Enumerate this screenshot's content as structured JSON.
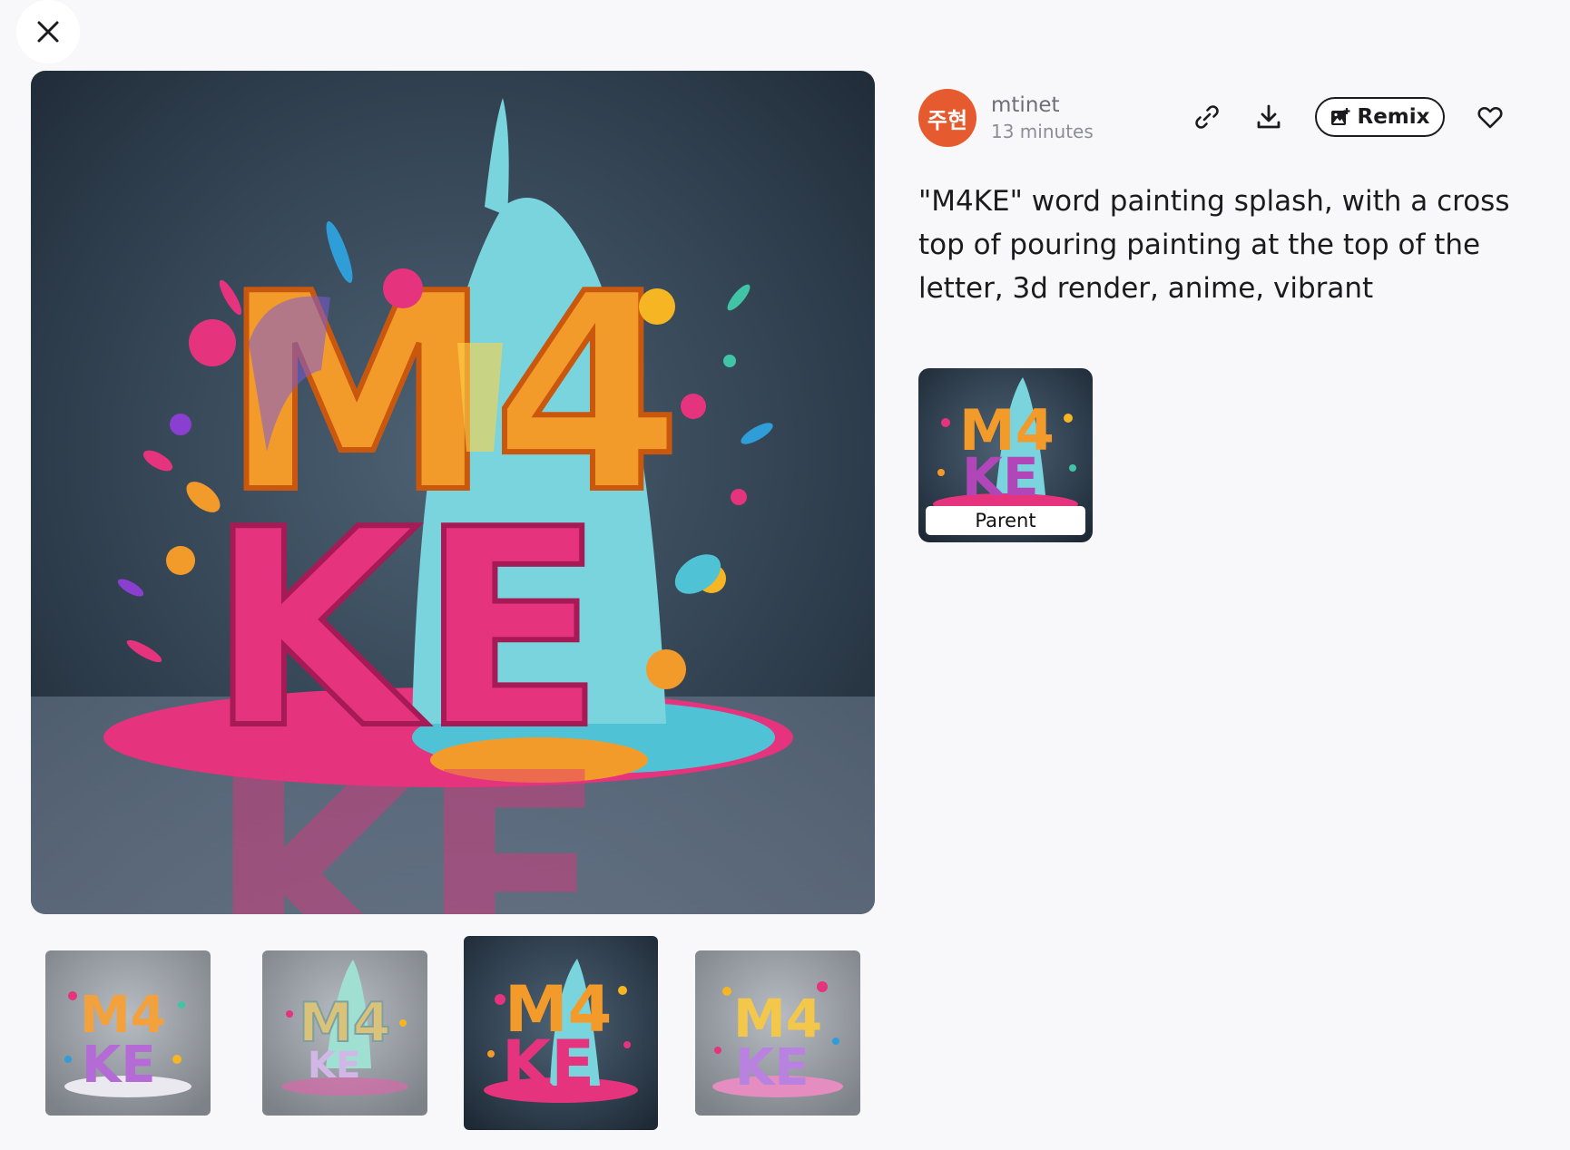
{
  "author": {
    "avatar_text": "주현",
    "avatar_color": "#e55a2e",
    "username": "mtinet",
    "timestamp": "13 minutes"
  },
  "actions": {
    "link_icon": "link-icon",
    "download_icon": "download-icon",
    "remix_label": "Remix",
    "remix_icon": "image-plus-icon",
    "like_icon": "heart-icon"
  },
  "prompt": "\"M4KE\" word painting splash, with a cross top of pouring painting at the top of the letter, 3d render, anime, vibrant",
  "parent": {
    "label": "Parent"
  },
  "gallery": {
    "selected_index": 2,
    "thumbnails": [
      "variation-1",
      "variation-2",
      "variation-3",
      "variation-4"
    ]
  },
  "artwork_text": {
    "line1": "M4",
    "line2": "KE"
  },
  "colors": {
    "background": "#f8f7fa",
    "accent": "#1b1b1f",
    "avatar": "#e55a2e"
  }
}
